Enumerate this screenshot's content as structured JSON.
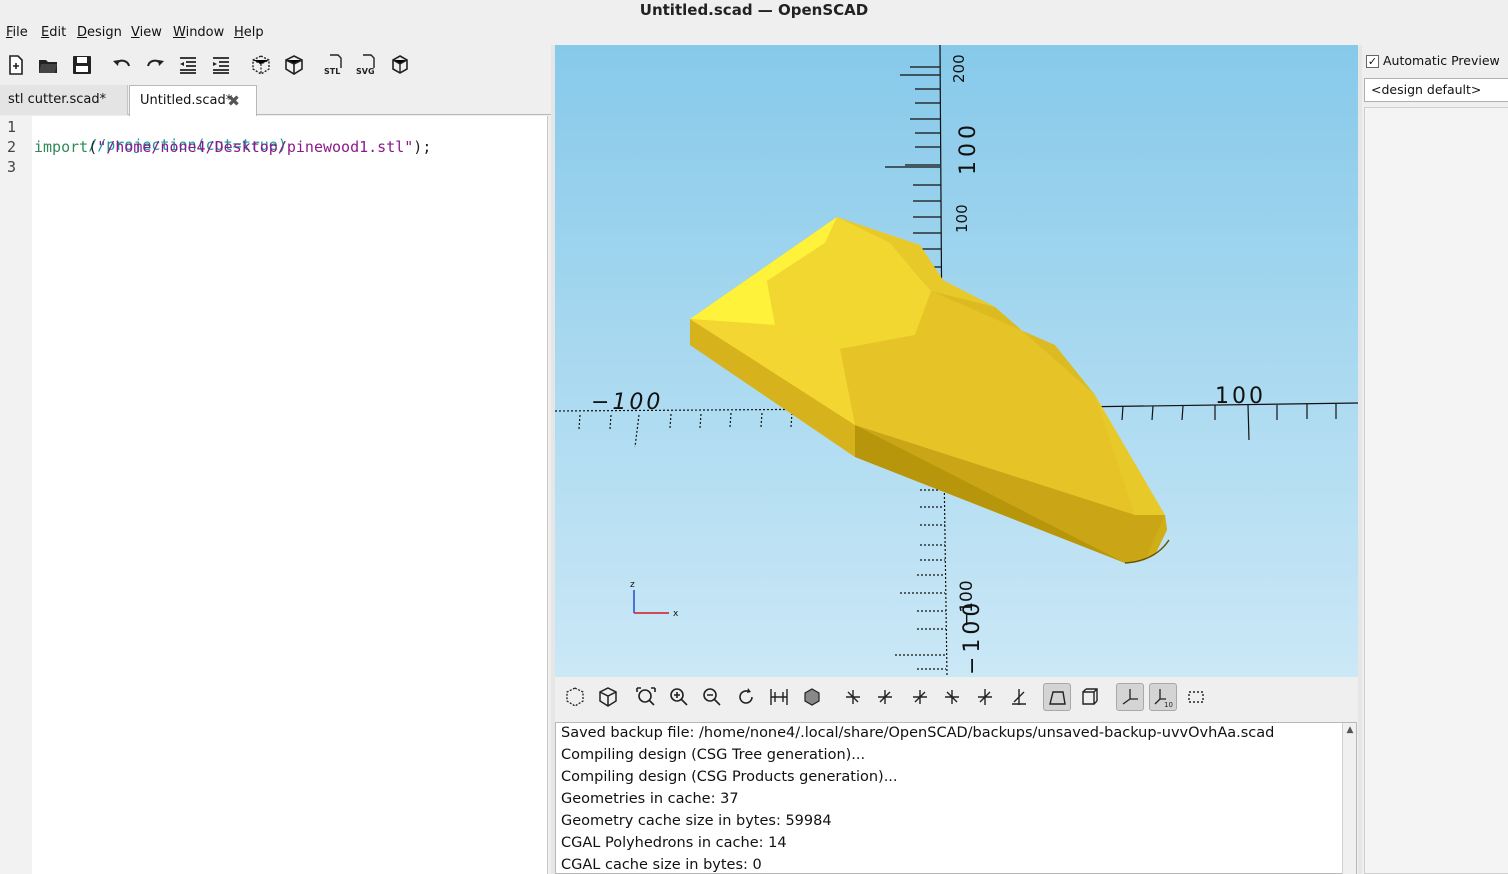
{
  "window": {
    "title": "Untitled.scad — OpenSCAD"
  },
  "menu": [
    "File",
    "Edit",
    "Design",
    "View",
    "Window",
    "Help"
  ],
  "editor_toolbar": [
    "new-file-icon",
    "open-file-icon",
    "save-file-icon",
    "undo-icon",
    "redo-icon",
    "unindent-icon",
    "indent-icon",
    "preview-icon",
    "render-icon",
    "export-stl-icon",
    "export-svg-icon",
    "send-to-print-icon"
  ],
  "tabs": [
    {
      "label": "stl cutter.scad*",
      "active": false
    },
    {
      "label": "Untitled.scad*",
      "active": true
    }
  ],
  "tab_close_glyph": "✖",
  "editor": {
    "line_numbers": [
      "1",
      "2",
      "3"
    ],
    "lines": [
      {
        "parts": [
          {
            "t": "//projection(cut=true)",
            "c": "comment"
          }
        ]
      },
      {
        "parts": [
          {
            "t": "import",
            "c": "kw"
          },
          {
            "t": "(",
            "c": "punc"
          },
          {
            "t": "\"/home/none4/Desktop/pinewood1.stl\"",
            "c": "str"
          },
          {
            "t": ");",
            "c": "punc"
          }
        ]
      },
      {
        "parts": []
      }
    ]
  },
  "viewport": {
    "axis_labels": {
      "x_pos": "100",
      "x_neg": "−100",
      "z_upper_1": "200",
      "z_upper_2": "100",
      "z_upper_3": "100",
      "z_lower_1": "−100",
      "z_lower_2": "−100"
    },
    "orientation": {
      "z": "z",
      "x": "x"
    },
    "background_top": "#87c9ea",
    "model_color": "#f0d030"
  },
  "view_toolbar": [
    "preview-icon",
    "render-icon",
    "view-all-icon",
    "zoom-in-icon",
    "zoom-out-icon",
    "reset-view-icon",
    "perspective-toggle-icon",
    "orthogonal-toggle-icon",
    "view-right-icon",
    "view-left-icon",
    "view-top-icon",
    "view-bottom-icon",
    "view-front-icon",
    "view-back-icon",
    "perspective-icon",
    "orthogonal-icon",
    "show-axes-icon",
    "show-scale-icon",
    "show-edges-icon"
  ],
  "console": [
    "Saved backup file: /home/none4/.local/share/OpenSCAD/backups/unsaved-backup-uvvOvhAa.scad",
    "Compiling design (CSG Tree generation)...",
    "Compiling design (CSG Products generation)...",
    "Geometries in cache: 37",
    "Geometry cache size in bytes: 59984",
    "CGAL Polyhedrons in cache: 14",
    "CGAL cache size in bytes: 0"
  ],
  "customizer": {
    "auto_preview_label": "Automatic Preview",
    "auto_preview_checked": true,
    "preset": "<design default>"
  }
}
